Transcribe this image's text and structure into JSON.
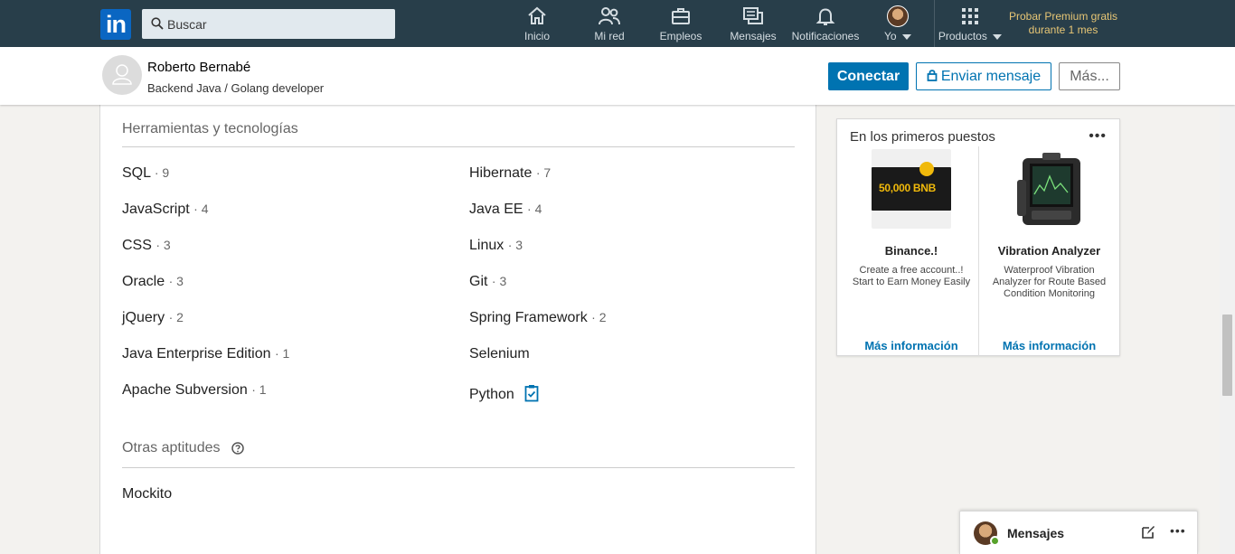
{
  "nav": {
    "logo_text": "in",
    "search_placeholder": "Buscar",
    "items": [
      {
        "label": "Inicio",
        "icon": "home-icon"
      },
      {
        "label": "Mi red",
        "icon": "network-icon"
      },
      {
        "label": "Empleos",
        "icon": "briefcase-icon"
      },
      {
        "label": "Mensajes",
        "icon": "messages-icon"
      },
      {
        "label": "Notificaciones",
        "icon": "bell-icon"
      },
      {
        "label": "Yo",
        "icon": "avatar"
      },
      {
        "label": "Productos",
        "icon": "grid-icon"
      }
    ],
    "premium_line1": "Probar Premium gratis",
    "premium_line2": "durante 1 mes"
  },
  "profile": {
    "name": "Roberto Bernabé",
    "headline": "Backend Java / Golang developer",
    "connect_label": "Conectar",
    "message_label": "Enviar mensaje",
    "more_label": "Más..."
  },
  "skills": {
    "tools_heading": "Herramientas y tecnologías",
    "tools_left": [
      {
        "name": "SQL",
        "count": "· 9"
      },
      {
        "name": "JavaScript",
        "count": "· 4"
      },
      {
        "name": "CSS",
        "count": "· 3"
      },
      {
        "name": "Oracle",
        "count": "· 3"
      },
      {
        "name": "jQuery",
        "count": "· 2"
      },
      {
        "name": "Java Enterprise Edition",
        "count": "· 1"
      },
      {
        "name": "Apache Subversion",
        "count": "· 1"
      }
    ],
    "tools_right": [
      {
        "name": "Hibernate",
        "count": "· 7"
      },
      {
        "name": "Java EE",
        "count": "· 4"
      },
      {
        "name": "Linux",
        "count": "· 3"
      },
      {
        "name": "Git",
        "count": "· 3"
      },
      {
        "name": "Spring Framework",
        "count": "· 2"
      },
      {
        "name": "Selenium",
        "count": ""
      },
      {
        "name": "Python",
        "count": ""
      }
    ],
    "other_heading": "Otras aptitudes",
    "other": [
      {
        "name": "Mockito"
      }
    ]
  },
  "ads": {
    "heading": "En los primeros puestos",
    "items": [
      {
        "name": "Binance.!",
        "desc": "Create a free account..! Start to Earn Money Easily",
        "link": "Más información",
        "image_text": "50,000 BNB"
      },
      {
        "name": "Vibration Analyzer",
        "desc": "Waterproof Vibration Analyzer for Route Based Condition Monitoring",
        "link": "Más información"
      }
    ]
  },
  "messaging": {
    "label": "Mensajes"
  },
  "colors": {
    "nav_bg": "#283e4a",
    "accent": "#0073b1",
    "premium": "#e7c675"
  }
}
